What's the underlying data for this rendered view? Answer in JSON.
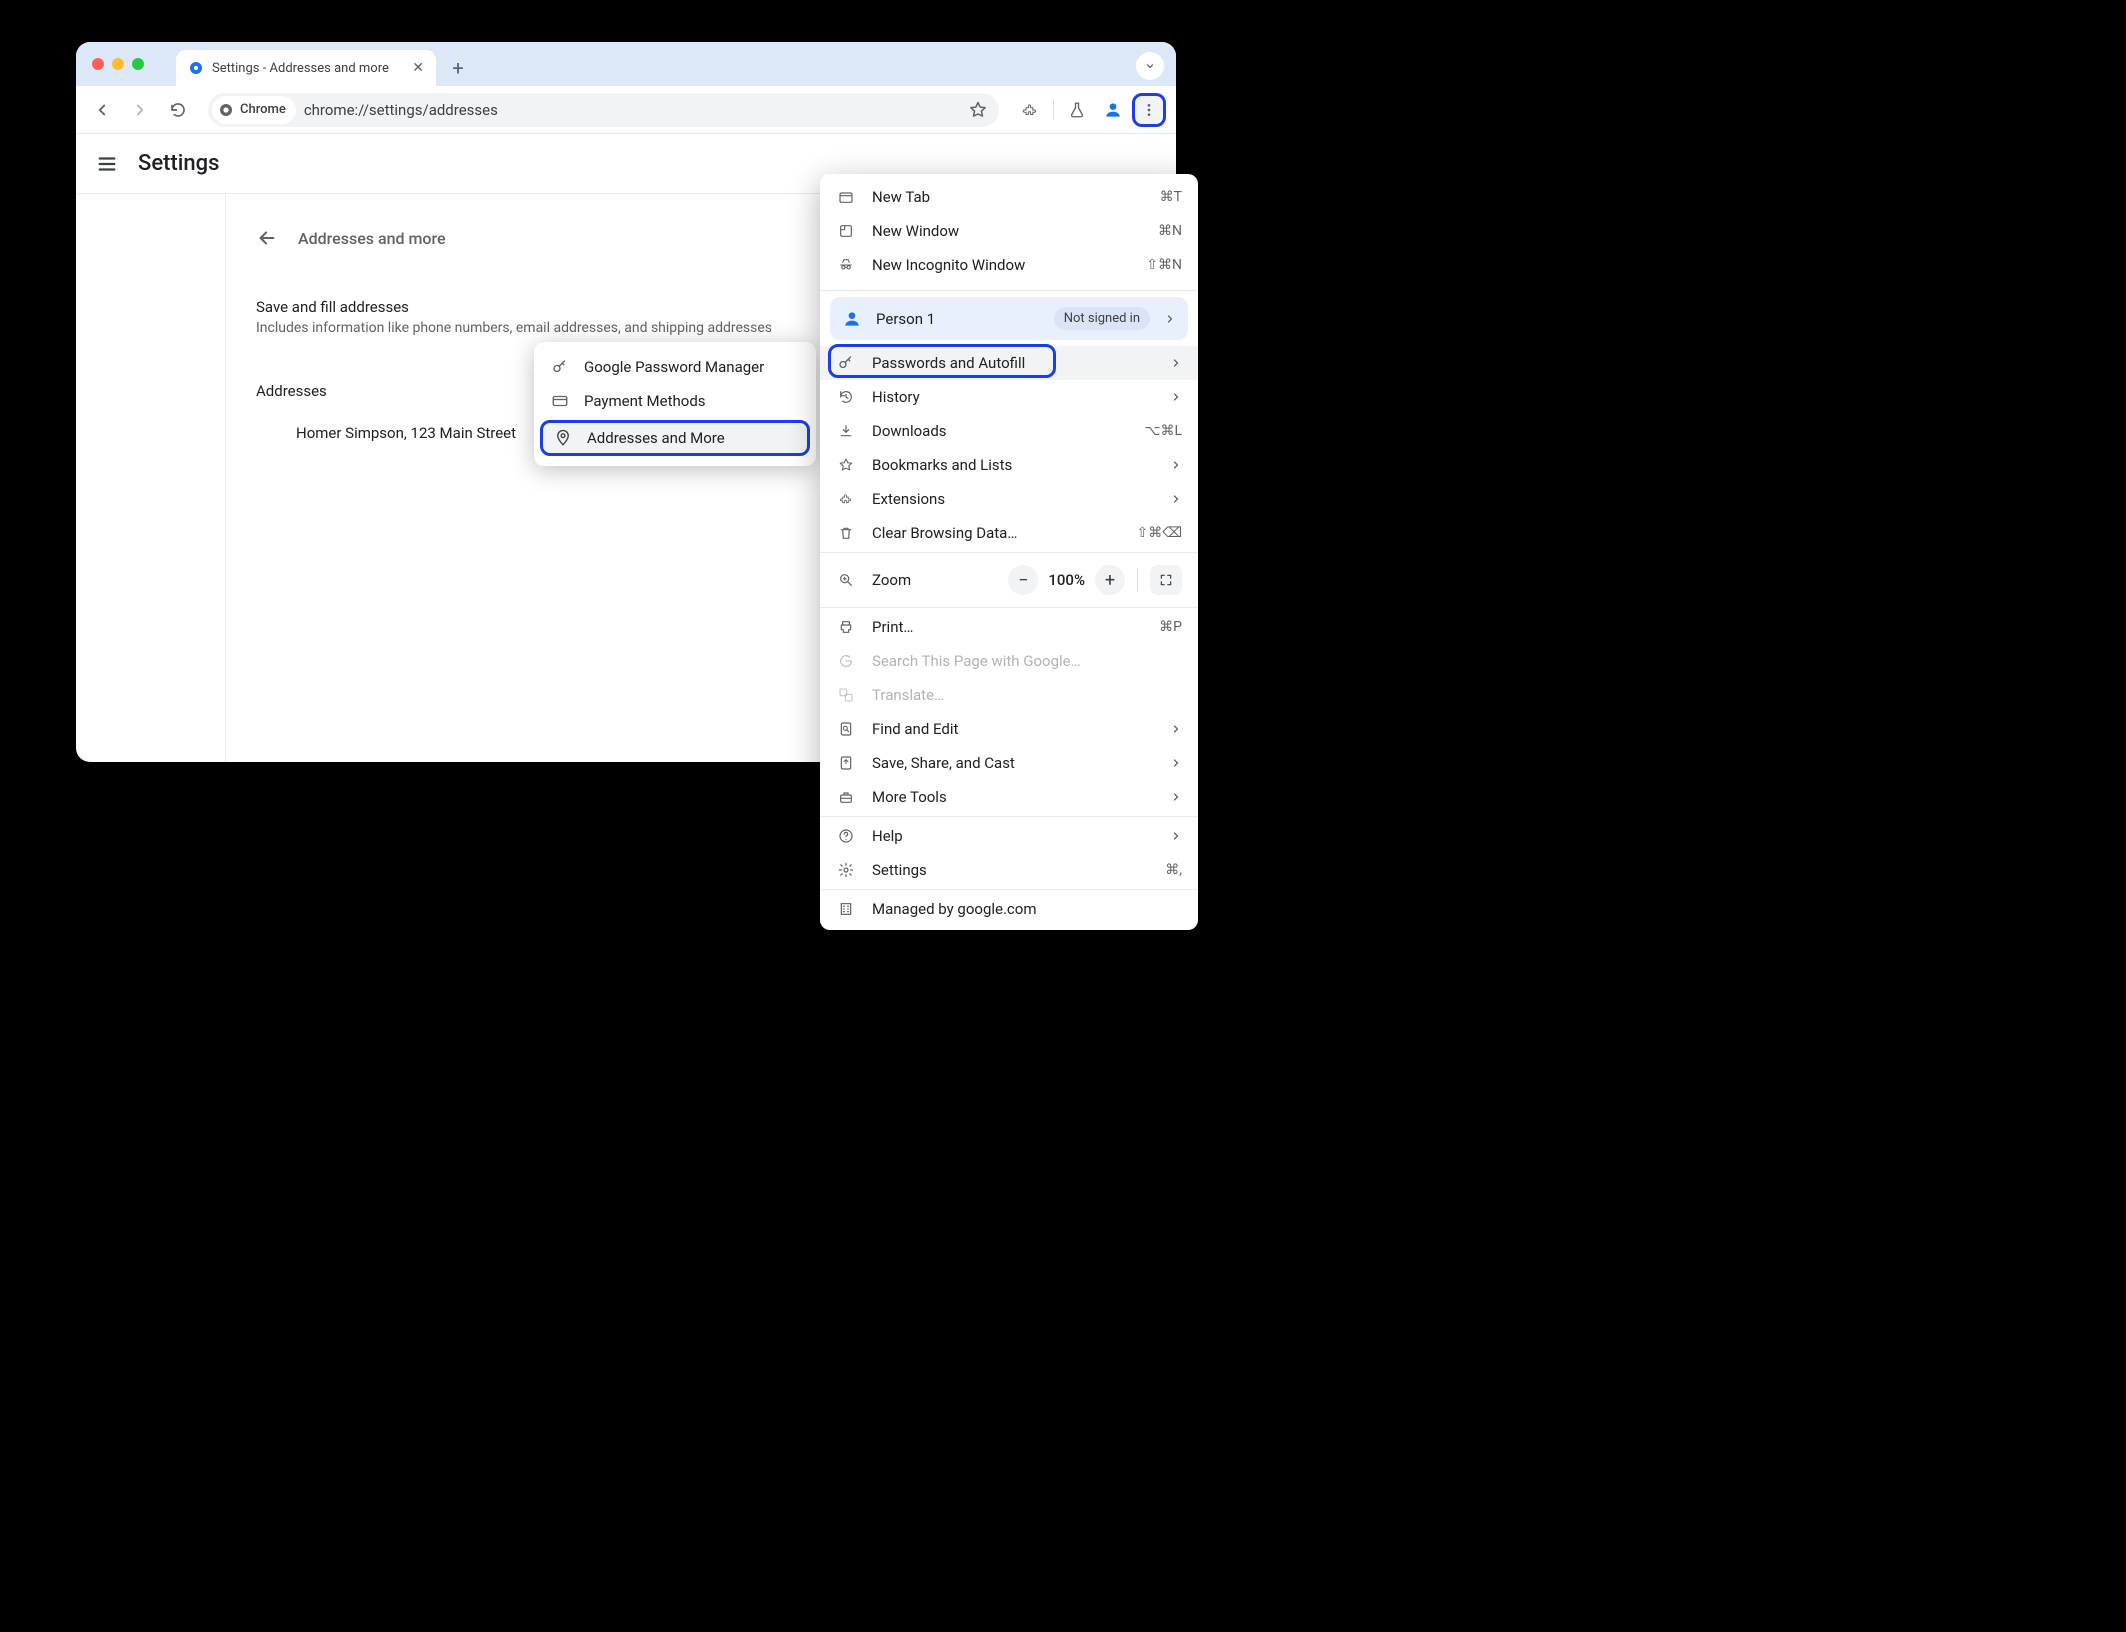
{
  "tab": {
    "title": "Settings - Addresses and more"
  },
  "omnibox": {
    "chip": "Chrome",
    "url": "chrome://settings/addresses"
  },
  "app": {
    "title": "Settings"
  },
  "subpage": {
    "title": "Addresses and more",
    "save_row_title": "Save and fill addresses",
    "save_row_sub": "Includes information like phone numbers, email addresses, and shipping addresses",
    "addresses_header": "Addresses",
    "address_item": "Homer Simpson, 123 Main Street"
  },
  "submenu": {
    "items": [
      {
        "icon": "key",
        "label": "Google Password Manager"
      },
      {
        "icon": "card",
        "label": "Payment Methods"
      },
      {
        "icon": "pin",
        "label": "Addresses and More"
      }
    ]
  },
  "overflow": {
    "new_tab": {
      "label": "New Tab",
      "accel": "⌘T"
    },
    "new_window": {
      "label": "New Window",
      "accel": "⌘N"
    },
    "incognito": {
      "label": "New Incognito Window",
      "accel": "⇧⌘N"
    },
    "profile": {
      "name": "Person 1",
      "badge": "Not signed in"
    },
    "passwords": {
      "label": "Passwords and Autofill"
    },
    "history": {
      "label": "History"
    },
    "downloads": {
      "label": "Downloads",
      "accel": "⌥⌘L"
    },
    "bookmarks": {
      "label": "Bookmarks and Lists"
    },
    "extensions": {
      "label": "Extensions"
    },
    "clear": {
      "label": "Clear Browsing Data…",
      "accel": "⇧⌘⌫"
    },
    "zoom": {
      "label": "Zoom",
      "value": "100%"
    },
    "print": {
      "label": "Print…",
      "accel": "⌘P"
    },
    "search_page": {
      "label": "Search This Page with Google…"
    },
    "translate": {
      "label": "Translate…"
    },
    "find": {
      "label": "Find and Edit"
    },
    "save_share": {
      "label": "Save, Share, and Cast"
    },
    "more_tools": {
      "label": "More Tools"
    },
    "help": {
      "label": "Help"
    },
    "settings": {
      "label": "Settings",
      "accel": "⌘,"
    },
    "managed": {
      "label": "Managed by google.com"
    }
  }
}
